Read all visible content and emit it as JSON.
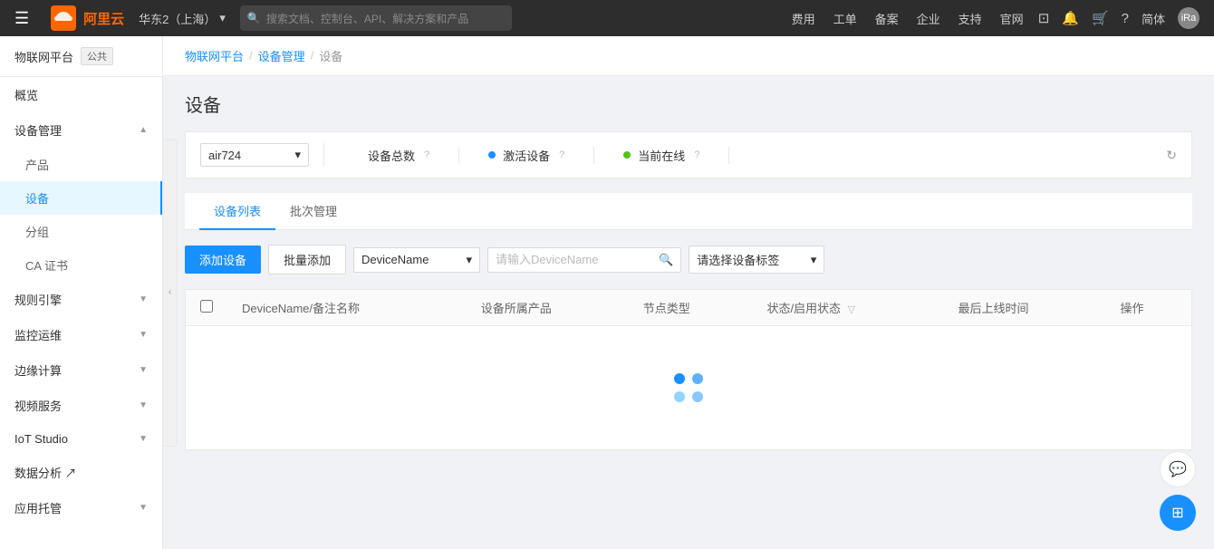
{
  "topNav": {
    "hamburger": "☰",
    "logoText": "阿里云",
    "region": "华东2（上海）",
    "searchPlaceholder": "搜索文档、控制台、API、解决方案和产品",
    "navItems": [
      "费用",
      "工单",
      "备案",
      "企业",
      "支持",
      "官网"
    ],
    "icons": [
      "⊡",
      "🔔",
      "🛒",
      "?",
      "简体"
    ]
  },
  "sidebar": {
    "platformLabel": "物联网平台",
    "platformBadge": "公共",
    "items": [
      {
        "label": "概览",
        "active": false,
        "hasChildren": false
      },
      {
        "label": "设备管理",
        "active": true,
        "hasChildren": true,
        "expanded": true,
        "children": [
          {
            "label": "产品",
            "active": false
          },
          {
            "label": "设备",
            "active": true
          },
          {
            "label": "分组",
            "active": false
          },
          {
            "label": "CA 证书",
            "active": false
          }
        ]
      },
      {
        "label": "规则引擎",
        "active": false,
        "hasChildren": true,
        "expanded": false
      },
      {
        "label": "监控运维",
        "active": false,
        "hasChildren": true,
        "expanded": false
      },
      {
        "label": "边缘计算",
        "active": false,
        "hasChildren": true,
        "expanded": false
      },
      {
        "label": "视频服务",
        "active": false,
        "hasChildren": true,
        "expanded": false
      },
      {
        "label": "IoT Studio",
        "active": false,
        "hasChildren": true,
        "expanded": false
      },
      {
        "label": "数据分析 ↗",
        "active": false,
        "hasChildren": false
      },
      {
        "label": "应用托管",
        "active": false,
        "hasChildren": true,
        "expanded": false
      }
    ]
  },
  "breadcrumb": {
    "items": [
      "物联网平台",
      "设备管理",
      "设备"
    ],
    "separators": [
      "/",
      "/"
    ]
  },
  "page": {
    "title": "设备",
    "productSelect": {
      "value": "air724",
      "placeholder": "air724"
    },
    "stats": [
      {
        "label": "设备总数",
        "hasDot": false,
        "hasHelp": true
      },
      {
        "label": "激活设备",
        "hasDot": true,
        "dotColor": "blue",
        "hasHelp": true
      },
      {
        "label": "当前在线",
        "hasDot": true,
        "dotColor": "green",
        "hasHelp": true
      }
    ],
    "tabs": [
      {
        "label": "设备列表",
        "active": true
      },
      {
        "label": "批次管理",
        "active": false
      }
    ],
    "toolbar": {
      "addButton": "添加设备",
      "batchAdd": "批量添加",
      "filterOptions": [
        "DeviceName"
      ],
      "searchPlaceholder": "请输入DeviceName",
      "tagSelectPlaceholder": "请选择设备标签"
    },
    "table": {
      "columns": [
        {
          "label": "DeviceName/备注名称"
        },
        {
          "label": "设备所属产品"
        },
        {
          "label": "节点类型"
        },
        {
          "label": "状态/启用状态",
          "hasFilter": true
        },
        {
          "label": "最后上线时间"
        },
        {
          "label": "操作"
        }
      ]
    }
  },
  "loadingDots": [
    {
      "color": "#1890ff",
      "opacity": 1
    },
    {
      "color": "#1890ff",
      "opacity": 0.6
    },
    {
      "color": "#91d5ff",
      "opacity": 0.4
    },
    {
      "color": "#1890ff",
      "opacity": 0.8
    }
  ]
}
